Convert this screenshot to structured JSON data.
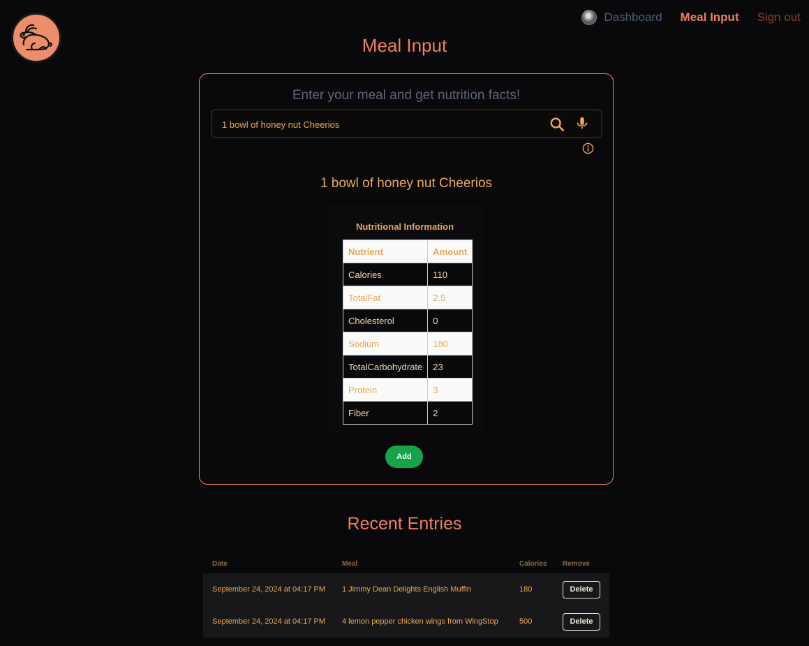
{
  "nav": {
    "dashboard_label": "Dashboard",
    "meal_input_label": "Meal Input",
    "sign_out_label": "Sign out"
  },
  "page": {
    "title": "Meal Input"
  },
  "meal_form": {
    "heading": "Enter your meal and get nutrition facts!",
    "search_value": "1 bowl of honey nut Cheerios",
    "result_title": "1 bowl of honey nut Cheerios",
    "add_label": "Add"
  },
  "nutrition": {
    "caption": "Nutritional Information",
    "headers": [
      "Nutrient",
      "Amount"
    ],
    "rows": [
      {
        "nutrient": "Calories",
        "amount": "110"
      },
      {
        "nutrient": "TotalFat",
        "amount": "2.5"
      },
      {
        "nutrient": "Cholesterol",
        "amount": "0"
      },
      {
        "nutrient": "Sodium",
        "amount": "180"
      },
      {
        "nutrient": "TotalCarbohydrate",
        "amount": "23"
      },
      {
        "nutrient": "Protein",
        "amount": "3"
      },
      {
        "nutrient": "Fiber",
        "amount": "2"
      }
    ]
  },
  "recent": {
    "title": "Recent Entries",
    "headers": [
      "Date",
      "Meal",
      "Calories",
      "Remove"
    ],
    "rows": [
      {
        "date": "September 24, 2024 at 04:17 PM",
        "meal": "1 Jimmy Dean Delights English Muffin",
        "calories": "180",
        "action": "Delete"
      },
      {
        "date": "September 24, 2024 at 04:17 PM",
        "meal": "4 lemon pepper chicken wings from WingStop",
        "calories": "500",
        "action": "Delete"
      }
    ]
  },
  "icons": {
    "logo": "rabbit-logo-icon",
    "avatar": "user-avatar",
    "search": "search-icon",
    "mic": "microphone-icon",
    "info": "info-icon"
  },
  "colors": {
    "background": "#09090b",
    "accent": "#ee7f62",
    "text": "#e8a857",
    "add_button": "#16a34a",
    "nav_dashboard": "#4f5d75",
    "nav_signout": "#8a3e2e"
  }
}
